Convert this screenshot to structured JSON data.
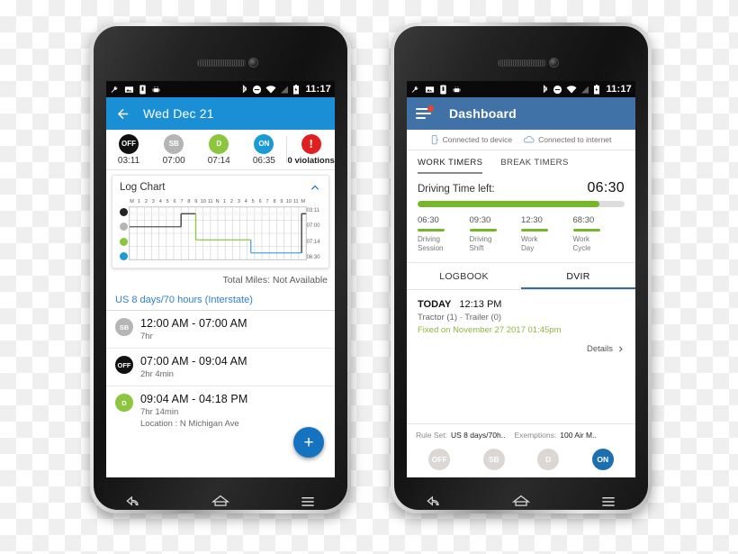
{
  "statusbar": {
    "time": "11:17",
    "left_icons": [
      "wrench-icon",
      "image-icon",
      "sim-card-icon",
      "android-icon"
    ],
    "right_icons": [
      "bluetooth-icon",
      "do-not-disturb-icon",
      "wifi-icon",
      "signal-icon",
      "battery-icon"
    ]
  },
  "left_phone": {
    "appbar": {
      "title": "Wed Dec 21",
      "back_icon": "back-arrow-icon",
      "color": "#1b8fd6"
    },
    "duty_summary": [
      {
        "code": "OFF",
        "time": "03:11",
        "color": "#111111"
      },
      {
        "code": "SB",
        "time": "07:00",
        "color": "#b5b5b5"
      },
      {
        "code": "D",
        "time": "07:14",
        "color": "#8cc63f"
      },
      {
        "code": "ON",
        "time": "06:35",
        "color": "#1b9ad6"
      }
    ],
    "violations": {
      "label": "0 violations",
      "glyph": "!",
      "color": "#e02020"
    },
    "log_chart": {
      "title": "Log Chart",
      "collapse_icon": "chevron-up-icon",
      "hour_labels": [
        "M",
        "1",
        "2",
        "3",
        "4",
        "5",
        "6",
        "7",
        "8",
        "9",
        "10",
        "11",
        "N",
        "1",
        "2",
        "3",
        "4",
        "5",
        "6",
        "7",
        "8",
        "9",
        "10",
        "11",
        "M"
      ],
      "row_totals": [
        "03:11",
        "07:00",
        "07:14",
        "06:30"
      ],
      "row_colors": [
        "#222222",
        "#b5b5b5",
        "#8cc63f",
        "#1b9ad6"
      ],
      "segments": [
        {
          "row": 1,
          "start": 0,
          "end": 7,
          "color": "#555555"
        },
        {
          "row": 0,
          "start": 7,
          "end": 9,
          "color": "#333333"
        },
        {
          "row": 2,
          "start": 9,
          "end": 16.5,
          "color": "#8cc63f"
        },
        {
          "row": 3,
          "start": 16.5,
          "end": 23.4,
          "color": "#4da3e0"
        },
        {
          "row": 0,
          "start": 23.4,
          "end": 24,
          "color": "#333333"
        }
      ]
    },
    "total_miles": "Total Miles: Not Available",
    "ruleset_link": "US 8 days/70 hours (Interstate)",
    "log_entries": [
      {
        "code": "SB",
        "color": "#b5b5b5",
        "time": "12:00 AM - 07:00 AM",
        "duration": "7hr",
        "location": ""
      },
      {
        "code": "OFF",
        "color": "#111111",
        "time": "07:00 AM - 09:04 AM",
        "duration": "2hr 4min",
        "location": ""
      },
      {
        "code": "D",
        "color": "#8cc63f",
        "time": "09:04 AM - 04:18 PM",
        "duration": "7hr 14min",
        "location": "Location : N Michigan Ave"
      }
    ],
    "fab": {
      "icon": "plus-icon",
      "label": "+",
      "color": "#1673c0"
    },
    "navigation": [
      "back-nav-icon",
      "home-nav-icon",
      "menu-nav-icon"
    ]
  },
  "right_phone": {
    "appbar": {
      "title": "Dashboard",
      "menu_icon": "hamburger-menu-icon",
      "badge": true,
      "color": "#4072a8"
    },
    "connection": [
      {
        "icon": "device-icon",
        "label": "Connected to device"
      },
      {
        "icon": "cloud-icon",
        "label": "Connected to internet"
      }
    ],
    "timer_tabs": [
      {
        "label": "WORK TIMERS",
        "active": true
      },
      {
        "label": "BREAK TIMERS",
        "active": false
      }
    ],
    "driving_timer": {
      "label": "Driving Time left:",
      "value": "06:30",
      "progress_percent": 88,
      "bar_color": "#76b72a"
    },
    "mini_timers": [
      {
        "value": "06:30",
        "caption_1": "Driving",
        "caption_2": "Session"
      },
      {
        "value": "09:30",
        "caption_1": "Driving",
        "caption_2": "Shift"
      },
      {
        "value": "12:30",
        "caption_1": "Work",
        "caption_2": "Day"
      },
      {
        "value": "68:30",
        "caption_1": "Work",
        "caption_2": "Cycle"
      }
    ],
    "content_tabs": [
      {
        "label": "LOGBOOK",
        "active": false
      },
      {
        "label": "DVIR",
        "active": true
      }
    ],
    "dvir": {
      "day": "TODAY",
      "time": "12:13 PM",
      "subtitle": "Tractor (1) · Trailer (0)",
      "fixed_note": "Fixed on November 27 2017 01:45pm",
      "details_label": "Details",
      "details_icon": "chevron-right-icon"
    },
    "footer": {
      "ruleset_label": "Rule Set:",
      "ruleset_value": "US 8 days/70h..",
      "exemptions_label": "Exemptions:",
      "exemptions_value": "100 Air M.."
    },
    "status_buttons": [
      {
        "code": "OFF",
        "active": false
      },
      {
        "code": "SB",
        "active": false
      },
      {
        "code": "D",
        "active": false
      },
      {
        "code": "ON",
        "active": true
      }
    ],
    "navigation": [
      "back-nav-icon",
      "home-nav-icon",
      "menu-nav-icon"
    ]
  }
}
